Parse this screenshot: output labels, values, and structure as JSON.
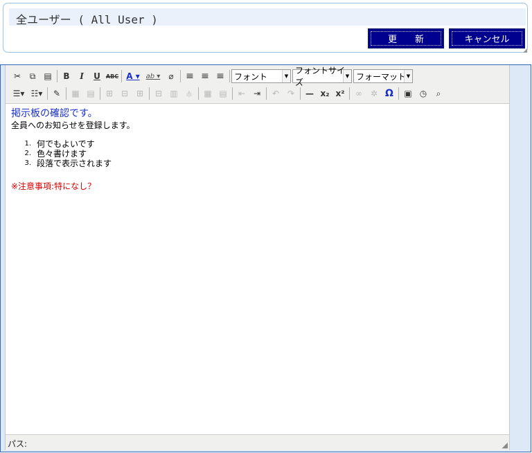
{
  "header": {
    "title": "全ユーザー ( All User )",
    "update_label": "更　　新",
    "cancel_label": "キャンセル"
  },
  "toolbar": {
    "row1": [
      {
        "icon": "cut-icon",
        "glyph": "✂"
      },
      {
        "icon": "copy-icon",
        "glyph": "⧉"
      },
      {
        "icon": "paste-icon",
        "glyph": "📋"
      },
      {
        "icon": "bold-icon",
        "glyph": "B"
      },
      {
        "icon": "italic-icon",
        "glyph": "I"
      },
      {
        "icon": "underline-icon",
        "glyph": "U"
      },
      {
        "icon": "strikethrough-icon",
        "glyph": "ABC"
      },
      {
        "icon": "font-color-icon",
        "glyph": "A"
      },
      {
        "icon": "highlight-color-icon",
        "glyph": "ab"
      },
      {
        "icon": "eraser-icon",
        "glyph": "⌫"
      },
      {
        "icon": "align-left-icon",
        "glyph": "≡"
      },
      {
        "icon": "align-center-icon",
        "glyph": "≡"
      },
      {
        "icon": "align-right-icon",
        "glyph": "≡"
      }
    ],
    "font_select": "フォント",
    "font_size_select": "フォントサイズ",
    "format_select": "フォーマット",
    "row2": [
      {
        "icon": "bullet-list-icon",
        "glyph": "☰"
      },
      {
        "icon": "numbered-list-icon",
        "glyph": "☷"
      },
      {
        "icon": "edit-source-icon",
        "glyph": "✎"
      },
      {
        "icon": "table-icon",
        "glyph": "▦"
      },
      {
        "icon": "table-props-icon",
        "glyph": "▤"
      },
      {
        "icon": "insert-row-icon",
        "glyph": "⊞"
      },
      {
        "icon": "delete-row-icon",
        "glyph": "⊟"
      },
      {
        "icon": "insert-col-icon",
        "glyph": "⊞"
      },
      {
        "icon": "delete-col-icon",
        "glyph": "⊟"
      },
      {
        "icon": "merge-cells-icon",
        "glyph": "▥"
      },
      {
        "icon": "split-cells-icon",
        "glyph": "▦"
      },
      {
        "icon": "outdent-icon",
        "glyph": "⇤"
      },
      {
        "icon": "indent-icon",
        "glyph": "⇥"
      },
      {
        "icon": "undo-icon",
        "glyph": "↶"
      },
      {
        "icon": "redo-icon",
        "glyph": "↷"
      },
      {
        "icon": "horizontal-rule-icon",
        "glyph": "—"
      },
      {
        "icon": "subscript-icon",
        "glyph": "x₂"
      },
      {
        "icon": "superscript-icon",
        "glyph": "x²"
      },
      {
        "icon": "link-icon",
        "glyph": "∞"
      },
      {
        "icon": "unlink-icon",
        "glyph": "✲"
      },
      {
        "icon": "special-char-icon",
        "glyph": "Ω"
      },
      {
        "icon": "date-icon",
        "glyph": "▣"
      },
      {
        "icon": "time-icon",
        "glyph": "◷"
      },
      {
        "icon": "preview-icon",
        "glyph": "🔍"
      }
    ]
  },
  "content": {
    "heading": "掲示板の確認です。",
    "intro": "全員へのお知らせを登録します。",
    "list": [
      {
        "num": "1.",
        "text": "何でもよいです"
      },
      {
        "num": "2.",
        "text": "色々書けます"
      },
      {
        "num": "3.",
        "text": "段落で表示されます"
      }
    ],
    "notice": "※注意事項:特になし？"
  },
  "statusbar": {
    "path_label": "パス:"
  },
  "colors": {
    "button_bg": "#00008f",
    "heading": "#1a2fc9",
    "notice": "#d40000",
    "frame_border": "#3a64b8"
  }
}
